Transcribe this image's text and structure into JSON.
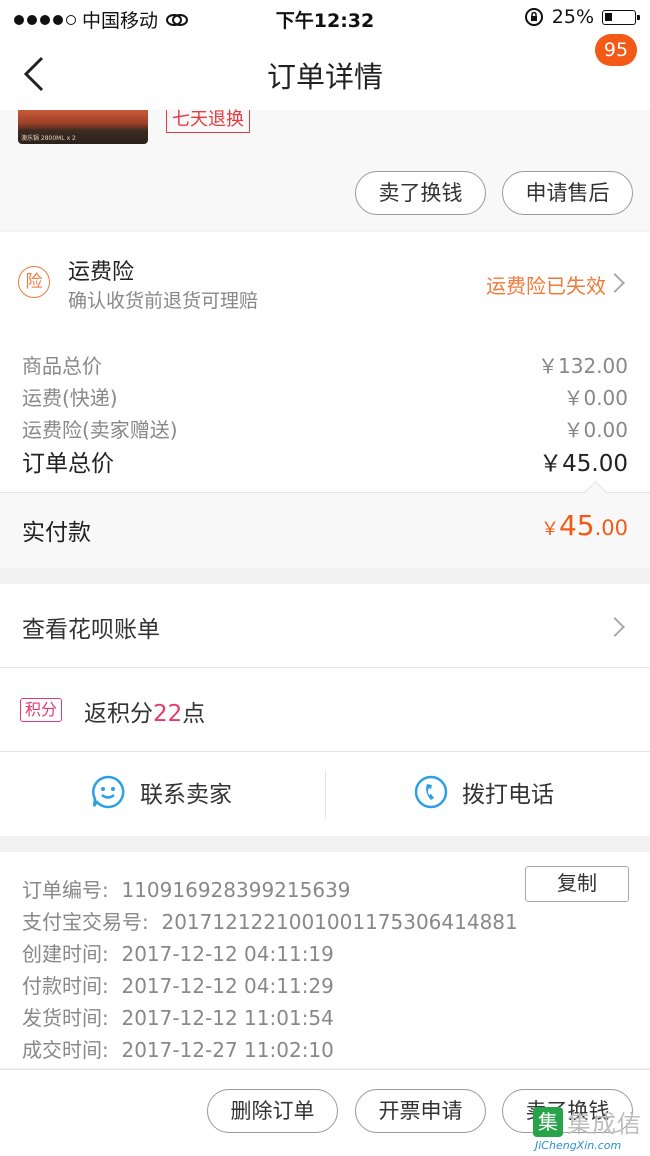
{
  "status_bar": {
    "carrier": "中国移动",
    "time": "下午12:32",
    "battery": "25%"
  },
  "nav": {
    "title": "订单详情",
    "badge": "95"
  },
  "product": {
    "image_label": "澳乐锅 2800ML x 2",
    "return_tag": "七天退换"
  },
  "top_actions": {
    "sell_label": "卖了换钱",
    "after_sale_label": "申请售后"
  },
  "insurance": {
    "icon_text": "险",
    "title": "运费险",
    "subtitle": "确认收货前退货可理赔",
    "status": "运费险已失效"
  },
  "prices": {
    "rows": [
      {
        "label": "商品总价",
        "value": "￥132.00"
      },
      {
        "label": "运费(快递)",
        "value": "￥0.00"
      },
      {
        "label": "运费险(卖家赠送)",
        "value": "￥0.00"
      }
    ],
    "total_label": "订单总价",
    "total_value": "￥45.00",
    "paid_label": "实付款",
    "paid_currency": "￥",
    "paid_int": "45",
    "paid_dec": ".00"
  },
  "huabei": {
    "label": "查看花呗账单"
  },
  "points": {
    "tag": "积分",
    "prefix": "返积分",
    "amount": "22",
    "suffix": "点"
  },
  "contact": {
    "seller_label": "联系卖家",
    "phone_label": "拨打电话"
  },
  "order_info": {
    "copy_label": "复制",
    "lines": [
      {
        "label": "订单编号:",
        "value": "110916928399215639"
      },
      {
        "label": "支付宝交易号:",
        "value": "2017121221001001175306414881"
      },
      {
        "label": "创建时间:",
        "value": "2017-12-12 04:11:19"
      },
      {
        "label": "付款时间:",
        "value": "2017-12-12 04:11:29"
      },
      {
        "label": "发货时间:",
        "value": "2017-12-12 11:01:54"
      },
      {
        "label": "成交时间:",
        "value": "2017-12-27 11:02:10"
      }
    ]
  },
  "bottom_actions": {
    "delete_label": "删除订单",
    "invoice_label": "开票申请",
    "sell_label": "卖了换钱"
  },
  "watermark": {
    "text": "集成信",
    "site": "JiChengXin.com"
  },
  "colors": {
    "accent": "#f35a17",
    "points": "#e63a6e",
    "tag_red": "#e63a42",
    "insurance": "#f07a3a"
  }
}
